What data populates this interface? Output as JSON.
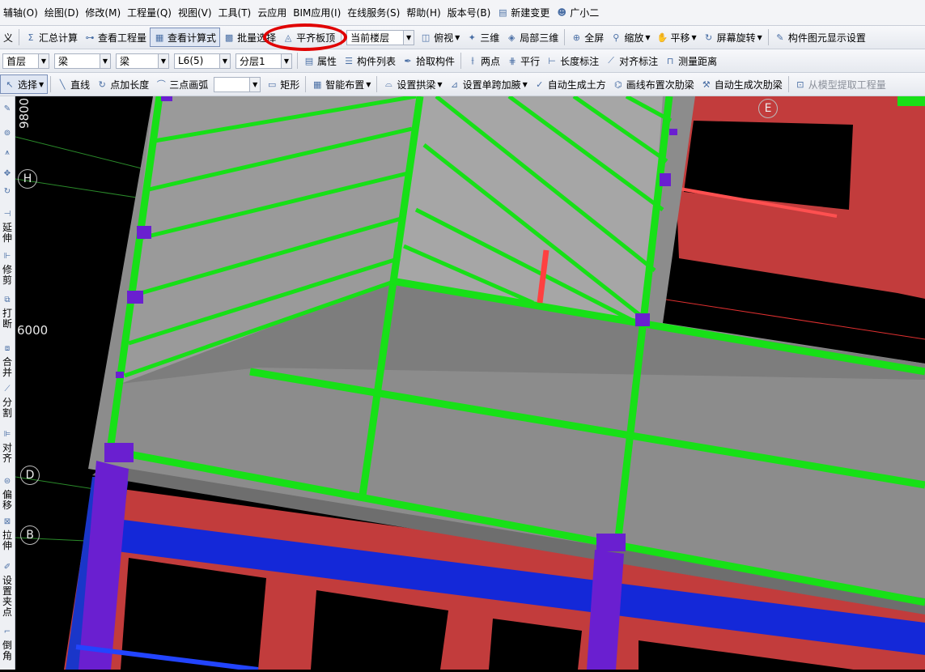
{
  "menubar": {
    "items": [
      "辅轴(O)",
      "绘图(D)",
      "修改(M)",
      "工程量(Q)",
      "视图(V)",
      "工具(T)",
      "云应用",
      "BIM应用(I)",
      "在线服务(S)",
      "帮助(H)",
      "版本号(B)"
    ],
    "new_change": "新建变更",
    "assistant": "广小二"
  },
  "toolbar1": {
    "cut_label": "义",
    "summary": "汇总计算",
    "view_quantity": "查看工程量",
    "view_formula": "查看计算式",
    "batch_select": "批量选择",
    "align_slab_top": "平齐板顶",
    "floor_select": "当前楼层",
    "top_view": "俯视",
    "three_d": "三维",
    "local_3d": "局部三维",
    "fullscreen": "全屏",
    "zoom": "缩放",
    "pan": "平移",
    "rotate": "屏幕旋转",
    "display_settings": "构件图元显示设置"
  },
  "toolbar2": {
    "floor": "首层",
    "category": "梁",
    "type": "梁",
    "component": "L6(5)",
    "sublayer": "分层1",
    "properties": "属性",
    "component_list": "构件列表",
    "pick": "拾取构件",
    "two_points": "两点",
    "parallel": "平行",
    "length_mark": "长度标注",
    "align_mark": "对齐标注",
    "measure": "测量距离"
  },
  "toolbar3": {
    "select": "选择",
    "line": "直线",
    "point_length": "点加长度",
    "arc": "三点画弧",
    "rect": "矩形",
    "smart_layout": "智能布置",
    "set_arch": "设置拱梁",
    "set_haunch": "设置单跨加腋",
    "auto_soil": "自动生成土方",
    "draw_secondary": "画线布置次肋梁",
    "auto_secondary": "自动生成次肋梁",
    "extract": "从模型提取工程量"
  },
  "sidebar": {
    "extend": "延伸",
    "trim": "修剪",
    "break": "打断",
    "merge": "合并",
    "split": "分割",
    "align": "对齐",
    "offset": "偏移",
    "stretch": "拉伸",
    "set_grip": "设置夹点",
    "chamfer": "倒角"
  },
  "viewport": {
    "dim_top": "9800",
    "dim_left": "6000",
    "axis_h": "H",
    "axis_d": "D",
    "axis_b": "B",
    "axis_e": "E"
  },
  "colors": {
    "beam_green": "#17e017",
    "column_purple": "#6a1fd0",
    "wall_red": "#c23c3c",
    "slab_gray": "#8c8c8c",
    "blue_beam": "#1428d8",
    "annotation": "#e00000"
  }
}
